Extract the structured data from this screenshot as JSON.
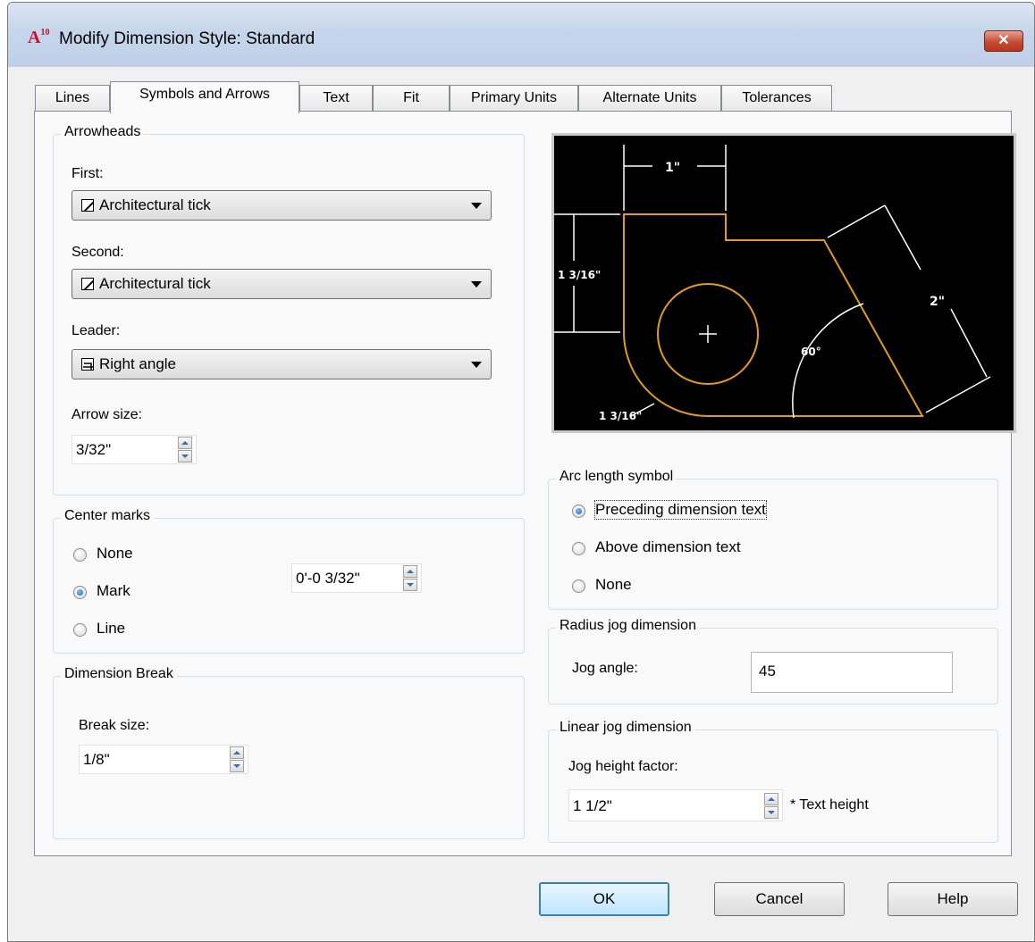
{
  "window": {
    "title": "Modify Dimension Style: Standard",
    "app_icon": "A10",
    "close_label": "✕"
  },
  "tabs": [
    "Lines",
    "Symbols and Arrows",
    "Text",
    "Fit",
    "Primary Units",
    "Alternate Units",
    "Tolerances"
  ],
  "arrowheads": {
    "legend": "Arrowheads",
    "first_label": "First:",
    "first_value": "Architectural tick",
    "second_label": "Second:",
    "second_value": "Architectural tick",
    "leader_label": "Leader:",
    "leader_value": "Right angle",
    "arrow_size_label": "Arrow size:",
    "arrow_size_value": "3/32\""
  },
  "center_marks": {
    "legend": "Center marks",
    "options": [
      "None",
      "Mark",
      "Line"
    ],
    "selected": "Mark",
    "size_value": "0'-0 3/32\""
  },
  "dimension_break": {
    "legend": "Dimension Break",
    "break_size_label": "Break size:",
    "break_size_value": "1/8\""
  },
  "preview": {
    "labels": [
      "1\"",
      "1 3/16\"",
      "2\"",
      "60°",
      "1 3/16\""
    ],
    "accent_color": "#e39b1b"
  },
  "arc_length": {
    "legend": "Arc length symbol",
    "options": [
      "Preceding dimension text",
      "Above dimension text",
      "None"
    ],
    "selected": "Preceding dimension text"
  },
  "radius_jog": {
    "legend": "Radius jog dimension",
    "jog_angle_label": "Jog angle:",
    "jog_angle_value": "45"
  },
  "linear_jog": {
    "legend": "Linear jog dimension",
    "factor_label": "Jog height factor:",
    "factor_value": "1 1/2\"",
    "suffix": "* Text height"
  },
  "buttons": {
    "ok": "OK",
    "cancel": "Cancel",
    "help": "Help"
  }
}
